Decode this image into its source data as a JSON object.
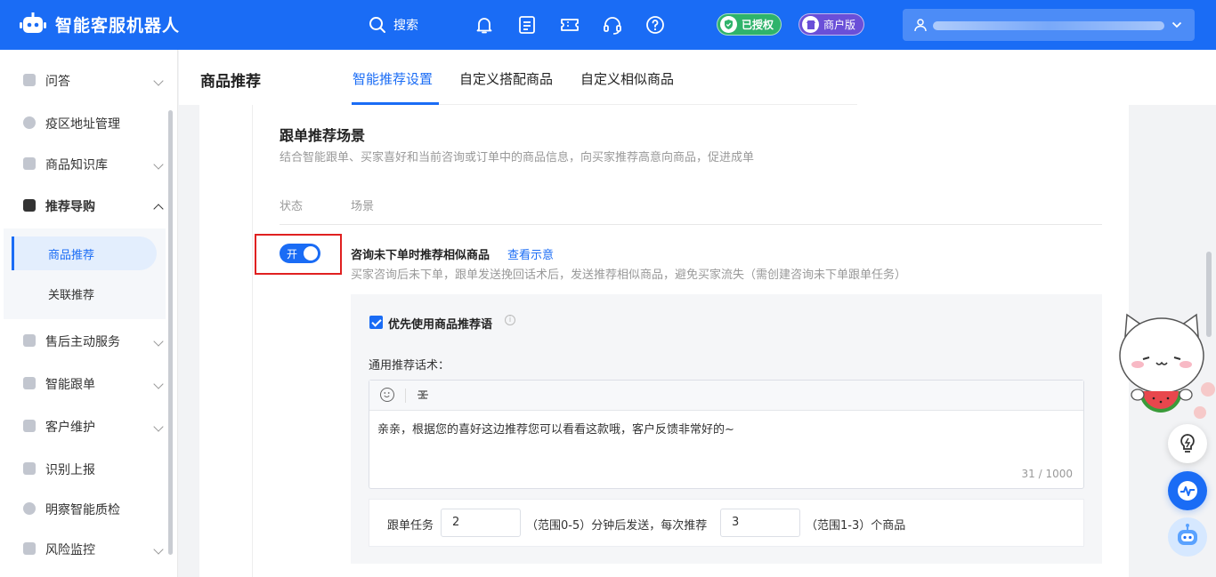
{
  "app": {
    "title": "智能客服机器人"
  },
  "topbar": {
    "search_label": "搜索",
    "auth_badge": "已授权",
    "merchant_badge": "商户版",
    "icons": [
      "bell-icon",
      "task-list-icon",
      "ticket-icon",
      "headset-icon",
      "help-icon"
    ]
  },
  "sidebar": {
    "items": [
      {
        "label": "问答",
        "icon": "chat-icon",
        "chevron": true
      },
      {
        "label": "疫区地址管理",
        "icon": "location-icon",
        "chevron": false
      },
      {
        "label": "商品知识库",
        "icon": "bag-icon",
        "chevron": true
      },
      {
        "label": "推荐导购",
        "icon": "recommend-icon",
        "chevron": true,
        "expanded": true
      },
      {
        "label": "售后主动服务",
        "icon": "service-icon",
        "chevron": true
      },
      {
        "label": "智能跟单",
        "icon": "follow-icon",
        "chevron": true
      },
      {
        "label": "客户维护",
        "icon": "customer-icon",
        "chevron": true
      },
      {
        "label": "识别上报",
        "icon": "report-icon",
        "chevron": false
      },
      {
        "label": "明察智能质检",
        "icon": "inspect-icon",
        "chevron": false
      },
      {
        "label": "风险监控",
        "icon": "risk-icon",
        "chevron": true
      }
    ],
    "submenu": [
      {
        "label": "商品推荐",
        "active": true
      },
      {
        "label": "关联推荐",
        "active": false
      }
    ]
  },
  "header": {
    "page_title": "商品推荐",
    "tabs": [
      {
        "label": "智能推荐设置",
        "active": true
      },
      {
        "label": "自定义搭配商品",
        "active": false
      },
      {
        "label": "自定义相似商品",
        "active": false
      }
    ]
  },
  "section": {
    "title": "跟单推荐场景",
    "description": "结合智能跟单、买家喜好和当前咨询或订单中的商品信息，向买家推荐高意向商品，促进成单",
    "col_status": "状态",
    "col_scene": "场景"
  },
  "scene": {
    "toggle_label": "开",
    "toggle_on": true,
    "title": "咨询未下单时推荐相似商品",
    "link": "查看示意",
    "description": "买家咨询后未下单，跟单发送挽回话术后，发送推荐相似商品，避免买家流失（需创建咨询未下单跟单任务）"
  },
  "settings": {
    "checkbox_label": "优先使用商品推荐语",
    "checkbox_checked": true,
    "script_label": "通用推荐话术：",
    "script_text": "亲亲，根据您的喜好这边推荐您可以看看这款哦，客户反馈非常好的~",
    "counter": "31 / 1000",
    "task_prefix": "跟单任务",
    "delay_value": "2",
    "delay_suffix": "（范围0-5）分钟后发送，每次推荐",
    "count_value": "3",
    "count_suffix": "（范围1-3）个商品"
  },
  "colors": {
    "primary": "#1a6cf5",
    "highlight_box": "#e02020",
    "auth_green": "#2fb36b",
    "merchant_purple": "#6a4fd8"
  }
}
